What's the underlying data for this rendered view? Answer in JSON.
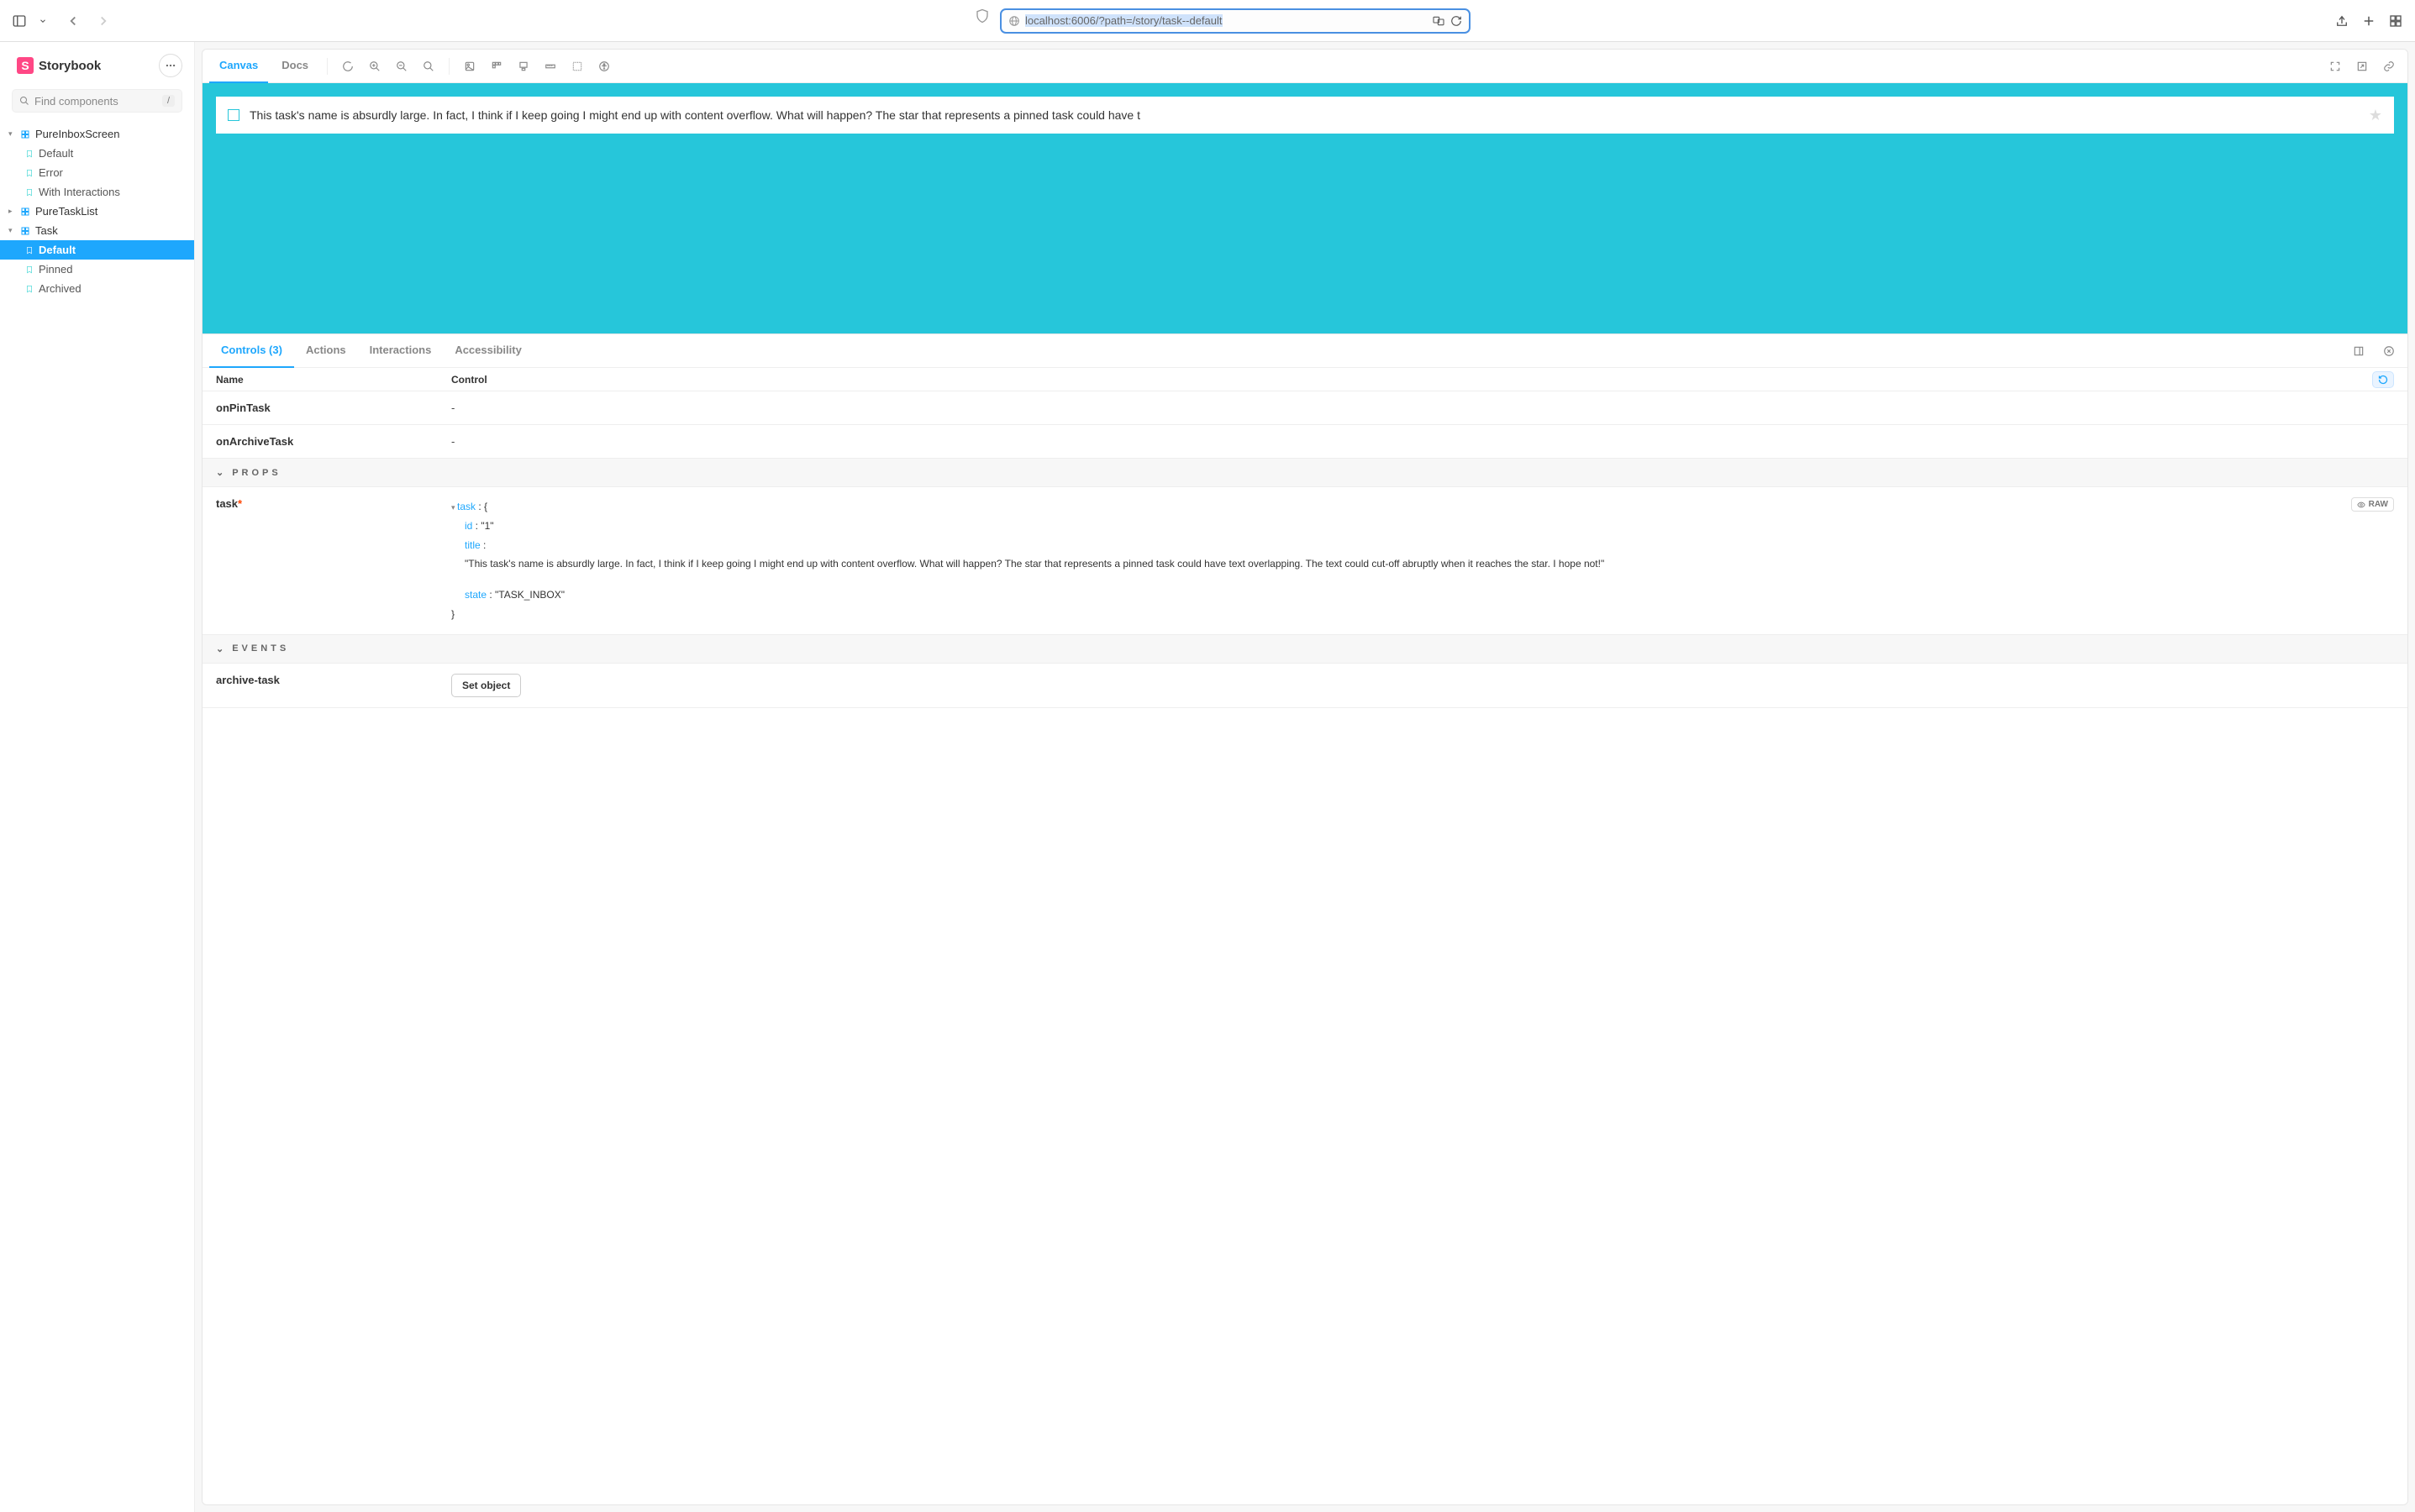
{
  "browser": {
    "url": "localhost:6006/?path=/story/task--default"
  },
  "sidebar": {
    "brand": "Storybook",
    "search_placeholder": "Find components",
    "search_kbd": "/",
    "groups": [
      {
        "name": "PureInboxScreen",
        "expanded": true,
        "stories": [
          "Default",
          "Error",
          "With Interactions"
        ]
      },
      {
        "name": "PureTaskList",
        "expanded": false,
        "stories": []
      },
      {
        "name": "Task",
        "expanded": true,
        "stories": [
          "Default",
          "Pinned",
          "Archived"
        ],
        "activeStory": "Default"
      }
    ]
  },
  "toolbar_tabs": {
    "canvas": "Canvas",
    "docs": "Docs"
  },
  "canvas": {
    "task_title": "This task's name is absurdly large. In fact, I think if I keep going I might end up with content overflow. What will happen? The star that represents a pinned task could have t"
  },
  "addon_tabs": {
    "controls": "Controls (3)",
    "actions": "Actions",
    "interactions": "Interactions",
    "a11y": "Accessibility"
  },
  "controls": {
    "header_name": "Name",
    "header_control": "Control",
    "rows": [
      {
        "name": "onPinTask",
        "control": "-"
      },
      {
        "name": "onArchiveTask",
        "control": "-"
      }
    ],
    "props_label": "PROPS",
    "events_label": "EVENTS",
    "task_label": "task",
    "task_obj": {
      "key_task": "task",
      "key_id": "id",
      "val_id": "\"1\"",
      "key_title": "title",
      "val_title": "\"This task's name is absurdly large. In fact, I think if I keep going I might end up with content overflow. What will happen? The star that represents a pinned task could have text overlapping. The text could cut-off abruptly when it reaches the star. I hope not!\"",
      "key_state": "state",
      "val_state": "\"TASK_INBOX\""
    },
    "raw_label": "RAW",
    "events": [
      {
        "name": "archive-task",
        "button": "Set object"
      }
    ]
  }
}
